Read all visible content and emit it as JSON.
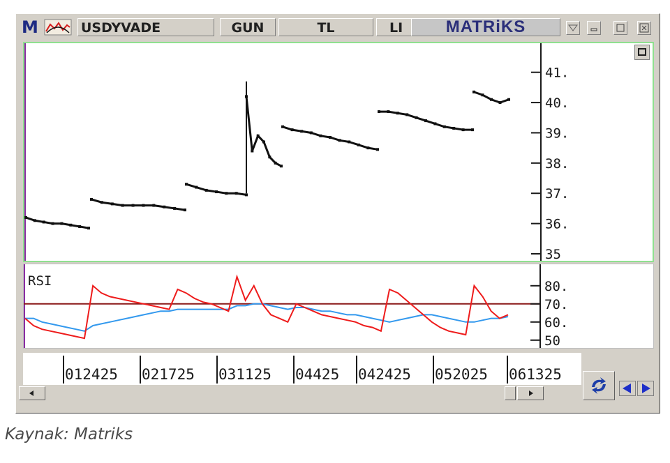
{
  "app": {
    "logo_letter": "M",
    "brand": "MATRiKS"
  },
  "titlebar": {
    "symbol": "USDYVADE",
    "period": "GUN",
    "currency": "TL",
    "extra": "LI"
  },
  "price_axis": {
    "ticks": [
      "41.",
      "40.",
      "39.",
      "38.",
      "37.",
      "36.",
      "35"
    ]
  },
  "rsi": {
    "label": "RSI",
    "ticks": [
      "80.",
      "70.",
      "60.",
      "50"
    ],
    "threshold": 70,
    "colors": {
      "rsi": "#ee1c1c",
      "signal": "#3399ee",
      "threshold": "#8b1a1a"
    }
  },
  "time_axis": {
    "labels": [
      "012425",
      "021725",
      "031125",
      "04425",
      "042425",
      "052025",
      "061325"
    ]
  },
  "chart_data": {
    "type": "line",
    "ylim": [
      35,
      41.5
    ],
    "price": [
      36.2,
      36.1,
      36.05,
      36.0,
      36.0,
      35.95,
      35.9,
      35.85,
      36.8,
      36.7,
      36.65,
      36.6,
      36.6,
      36.6,
      36.6,
      36.55,
      36.5,
      36.45,
      37.3,
      37.2,
      37.1,
      37.05,
      37.0,
      37.0,
      36.95,
      40.2,
      38.4,
      38.9,
      38.7,
      38.2,
      38.0,
      37.9,
      39.2,
      39.1,
      39.05,
      39.0,
      38.9,
      38.85,
      38.75,
      38.7,
      38.6,
      38.5,
      38.45,
      39.7,
      39.7,
      39.65,
      39.6,
      39.5,
      39.4,
      39.3,
      39.2,
      39.15,
      39.1,
      39.1,
      40.35,
      40.25,
      40.1,
      40.0,
      40.1
    ],
    "rsi_values": [
      62,
      58,
      56,
      55,
      54,
      53,
      52,
      51,
      80,
      76,
      74,
      73,
      72,
      71,
      70,
      69,
      68,
      67,
      78,
      76,
      73,
      71,
      70,
      68,
      66,
      85,
      72,
      80,
      70,
      64,
      62,
      60,
      70,
      68,
      66,
      64,
      63,
      62,
      61,
      60,
      58,
      57,
      55,
      78,
      76,
      72,
      68,
      64,
      60,
      57,
      55,
      54,
      53,
      80,
      74,
      66,
      62,
      64
    ],
    "signal_values": [
      62,
      62,
      60,
      59,
      58,
      57,
      56,
      55,
      58,
      59,
      60,
      61,
      62,
      63,
      64,
      65,
      66,
      66,
      67,
      67,
      67,
      67,
      67,
      67,
      67,
      69,
      69,
      70,
      70,
      69,
      68,
      67,
      68,
      68,
      67,
      66,
      66,
      65,
      64,
      64,
      63,
      62,
      61,
      60,
      61,
      62,
      63,
      64,
      64,
      63,
      62,
      61,
      60,
      60,
      61,
      62,
      62,
      63
    ]
  },
  "footer": {
    "caption": "Kaynak: Matriks"
  }
}
